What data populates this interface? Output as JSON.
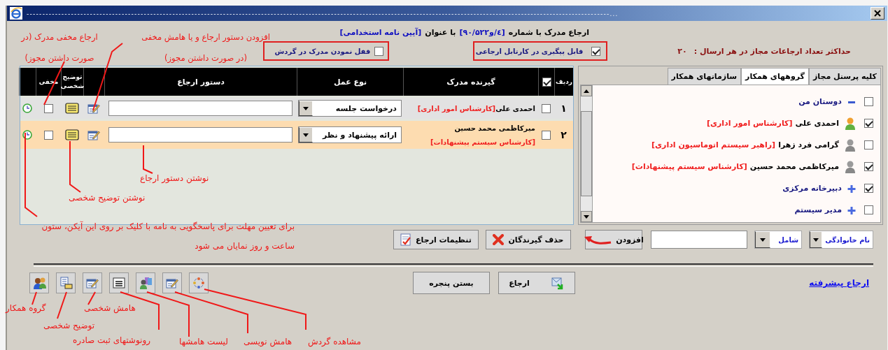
{
  "window": {
    "title": "----------------------------------------------------------------------------------------------------------------------------------------------------------------------------------------..."
  },
  "header": {
    "prefix": "ارجاع مدرک با شماره",
    "number": "[۹۰/٤/و۵۲۲]",
    "middle": "با عنوان",
    "subject": "[آیین نامه استخدامی]"
  },
  "max_referrals": {
    "label": "حداکثر تعداد ارجاعات مجاز در هر ارسال :",
    "value": "۲۰"
  },
  "options": [
    {
      "label": "قابل پیگیری در کارتابل ارجاعی",
      "checked": true
    },
    {
      "label": "قفل نمودن مدرک در گردش",
      "checked": false
    }
  ],
  "table": {
    "columns": {
      "row_number": "ردیف",
      "recipient": "گیرنده مدرک",
      "action": "نوع عمل",
      "instruction": "دستور ارجاع",
      "note": "توضیح شخصی",
      "hidden": "مخفی"
    },
    "select_all_checked": true,
    "rows": [
      {
        "number": "۱",
        "checked": false,
        "name": "احمدی علی",
        "role": "[کارشناس امور اداری]",
        "action": "درخواست جلسه",
        "hidden": false,
        "selected": false
      },
      {
        "number": "۲",
        "checked": false,
        "name": "میرکاظمی محمد حسین",
        "role": "[کارشناس سیستم پیشنهادات]",
        "action": "ارائه پیشنهاد و نظر",
        "hidden": false,
        "selected": true
      }
    ]
  },
  "tabs": [
    {
      "label": "کلیه پرسنل مجاز",
      "selected": false
    },
    {
      "label": "گروههای همکار",
      "selected": true
    },
    {
      "label": "سازمانهای همکار",
      "selected": false
    }
  ],
  "tree": [
    {
      "kind": "group",
      "label": "دوستان من",
      "checked": false,
      "expanded": true,
      "children": [
        {
          "kind": "person",
          "name": "احمدی علی",
          "role": "[کارشناس امور اداری]",
          "checked": true,
          "active": true
        },
        {
          "kind": "person",
          "name": "گرامی فرد زهرا",
          "role": "[راهبر سیستم اتوماسیون اداری]",
          "checked": false,
          "active": false
        },
        {
          "kind": "person",
          "name": "میرکاظمی محمد حسین",
          "role": "[کارشناس سیستم پیشنهادات]",
          "checked": true,
          "active": false
        }
      ]
    },
    {
      "kind": "group",
      "label": "دبیرخانه مرکزی",
      "checked": true,
      "expanded": false
    },
    {
      "kind": "group",
      "label": "مدیر سیستم",
      "checked": false,
      "expanded": false
    }
  ],
  "search": {
    "field": "نام خانوادگی",
    "operator": "شامل"
  },
  "actions": [
    {
      "kind": "add",
      "label": "افزودن"
    },
    {
      "kind": "remove",
      "label": "حذف گیرندگان"
    },
    {
      "kind": "settings",
      "label": "تنظیمات ارجاع"
    }
  ],
  "footer_buttons": [
    {
      "kind": "refer",
      "label": "ارجاع"
    },
    {
      "kind": "close",
      "label": "بستن پنجره"
    }
  ],
  "advanced_link": "ارجاع پیشرفته",
  "annotations": [
    {
      "text": "افزودن دستور ارجاع و یا هامش مخفی (در صورت داشتن مجوز)"
    },
    {
      "text": "ارجاع مخفی مدرک (در صورت داشتن مجوز)"
    },
    {
      "text": "نوشتن دستور ارجاع"
    },
    {
      "text": "نوشتن توضیح شخصی"
    },
    {
      "text": "برای تعیین مهلت برای پاسخگویی به نامه با کلیک بر روی این آیکن، ستون ساعت و روز نمایان می شود"
    },
    {
      "text": "هامش شخصی"
    },
    {
      "text": "گروه همکار"
    },
    {
      "text": "توضیح شخصی"
    },
    {
      "text": "مشاهده گردش"
    },
    {
      "text": "هامش نویسی"
    },
    {
      "text": "لیست هامشها"
    },
    {
      "text": "رونوشتهای ثبت صادره"
    }
  ]
}
